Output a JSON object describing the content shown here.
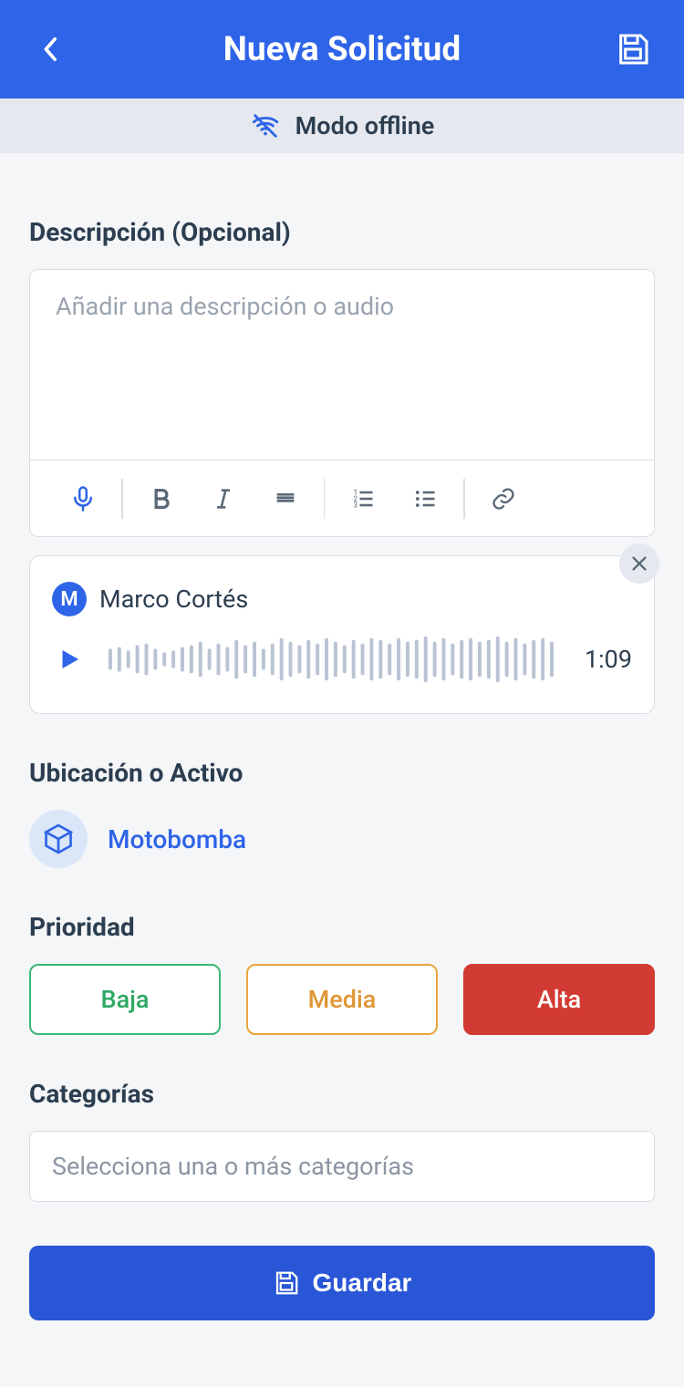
{
  "header": {
    "title": "Nueva Solicitud"
  },
  "offline": {
    "label": "Modo offline"
  },
  "description": {
    "label": "Descripción (Opcional)",
    "placeholder": "Añadir una descripción o audio"
  },
  "audio": {
    "author_initial": "M",
    "author_name": "Marco Cortés",
    "duration_label": "1:09"
  },
  "location": {
    "label": "Ubicación o Activo",
    "asset_name": "Motobomba"
  },
  "priority": {
    "label": "Prioridad",
    "options": {
      "baja": "Baja",
      "media": "Media",
      "alta": "Alta"
    }
  },
  "categories": {
    "label": "Categorías",
    "placeholder": "Selecciona una o más categorías"
  },
  "footer": {
    "save_label": "Guardar"
  }
}
